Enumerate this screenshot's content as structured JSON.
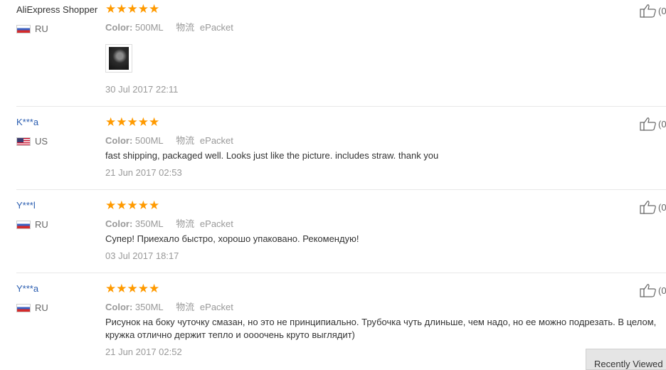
{
  "reviews": [
    {
      "user": "AliExpress Shopper",
      "country_flag": "ru-flag",
      "country": "RU",
      "stars": "★★★★★",
      "rating": 5,
      "color_label": "Color:",
      "color_value": "500ML",
      "shipping_label": "物流",
      "shipping_value": "ePacket",
      "comment": "",
      "has_photo": true,
      "date": "30 Jul 2017 22:11",
      "helpful": "(0"
    },
    {
      "user": "K***a",
      "country_flag": "us-flag",
      "country": "US",
      "stars": "★★★★★",
      "rating": 5,
      "color_label": "Color:",
      "color_value": "500ML",
      "shipping_label": "物流",
      "shipping_value": "ePacket",
      "comment": "fast shipping, packaged well. Looks just like the picture. includes straw. thank you",
      "has_photo": false,
      "date": "21 Jun 2017 02:53",
      "helpful": "(0"
    },
    {
      "user": "Y***l",
      "country_flag": "ru-flag",
      "country": "RU",
      "stars": "★★★★★",
      "rating": 5,
      "color_label": "Color:",
      "color_value": "350ML",
      "shipping_label": "物流",
      "shipping_value": "ePacket",
      "comment": "Супер! Приехало быстро, хорошо упаковано. Рекомендую!",
      "has_photo": false,
      "date": "03 Jul 2017 18:17",
      "helpful": "(0"
    },
    {
      "user": "Y***a",
      "country_flag": "ru-flag",
      "country": "RU",
      "stars": "★★★★★",
      "rating": 5,
      "color_label": "Color:",
      "color_value": "350ML",
      "shipping_label": "物流",
      "shipping_value": "ePacket",
      "comment": "Рисунок на боку чуточку смазан, но это не принципиально. Трубочка чуть длиньше, чем надо, но ее можно подрезать. В целом, кружка отлично держит тепло и оооочень круто выглядит)",
      "has_photo": false,
      "date": "21 Jun 2017 02:52",
      "helpful": "(0"
    }
  ],
  "recently_viewed": "Recently Viewed",
  "colors": {
    "star": "#ff9a00",
    "link": "#2a5db0",
    "muted": "#999999"
  }
}
